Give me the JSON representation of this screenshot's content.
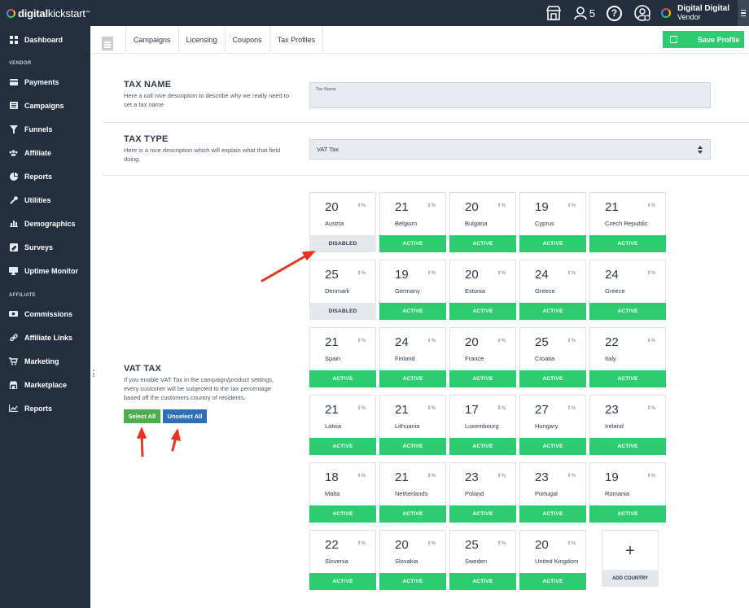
{
  "brand": {
    "logo_bold": "digital",
    "logo_light": "kickstart",
    "trademark": "™",
    "colors": {
      "dark": "#232f3e",
      "green": "#2ecc71",
      "blue": "#2f6fb3",
      "red_arrow": "#e8341c"
    }
  },
  "topbar": {
    "store_icon": "store-icon",
    "users_icon": "users-icon",
    "users_count": "5",
    "help_icon": "help-icon",
    "help_glyph": "?",
    "support_icon": "support-icon",
    "vendor_name": "Digital Digital",
    "vendor_role": "Vendor"
  },
  "sidebar": {
    "top": [
      {
        "label": "Dashboard",
        "icon": "dashboard-icon"
      }
    ],
    "vendor_heading": "VENDOR",
    "vendor": [
      {
        "label": "Payments",
        "icon": "payments-icon"
      },
      {
        "label": "Campaigns",
        "icon": "campaigns-icon"
      },
      {
        "label": "Funnels",
        "icon": "funnel-icon"
      },
      {
        "label": "Affiliate",
        "icon": "affiliate-icon"
      },
      {
        "label": "Reports",
        "icon": "reports-icon"
      },
      {
        "label": "Utilities",
        "icon": "wrench-icon"
      },
      {
        "label": "Demographics",
        "icon": "demographics-icon"
      },
      {
        "label": "Surveys",
        "icon": "surveys-icon"
      },
      {
        "label": "Uptime Monitor",
        "icon": "monitor-icon"
      }
    ],
    "affiliate_heading": "AFFILIATE",
    "affiliate": [
      {
        "label": "Commissions",
        "icon": "commissions-icon"
      },
      {
        "label": "Affiliate Links",
        "icon": "link-icon"
      },
      {
        "label": "Marketing",
        "icon": "cart-icon"
      },
      {
        "label": "Marketplace",
        "icon": "marketplace-icon"
      },
      {
        "label": "Reports",
        "icon": "line-chart-icon"
      }
    ]
  },
  "tabs": [
    "Campaigns",
    "Licensing",
    "Coupons",
    "Tax Profiles"
  ],
  "save_button": "Save Profile",
  "tax_name": {
    "title": "TAX NAME",
    "desc": "Here a coll nive description to describe why we really need to set a tax name",
    "placeholder": "Tax Name"
  },
  "tax_type": {
    "title": "TAX TYPE",
    "desc": "Here is a nice description which will explain what that field doing.",
    "value": "VAT Tax"
  },
  "vat_tax": {
    "title": "VAT TAX",
    "desc": "If you enable VAT Tax in the campaign/product settings, every customer will be subjected to the tax percentage based off the customers country of residents.",
    "select_all": "Select All",
    "unselect_all": "Unselect All"
  },
  "percent_label": "%",
  "countries": [
    {
      "rate": "20",
      "name": "Austria",
      "status": "DISABLED"
    },
    {
      "rate": "21",
      "name": "Belgium",
      "status": "ACTIVE"
    },
    {
      "rate": "20",
      "name": "Bulgaria",
      "status": "ACTIVE"
    },
    {
      "rate": "19",
      "name": "Cyprus",
      "status": "ACTIVE"
    },
    {
      "rate": "21",
      "name": "Czech Republic",
      "status": "ACTIVE"
    },
    {
      "rate": "25",
      "name": "Denmark",
      "status": "DISABLED"
    },
    {
      "rate": "19",
      "name": "Germany",
      "status": "ACTIVE"
    },
    {
      "rate": "20",
      "name": "Estonia",
      "status": "ACTIVE"
    },
    {
      "rate": "24",
      "name": "Greece",
      "status": "ACTIVE"
    },
    {
      "rate": "24",
      "name": "Greece",
      "status": "ACTIVE"
    },
    {
      "rate": "21",
      "name": "Spain",
      "status": "ACTIVE"
    },
    {
      "rate": "24",
      "name": "Finland",
      "status": "ACTIVE"
    },
    {
      "rate": "20",
      "name": "France",
      "status": "ACTIVE"
    },
    {
      "rate": "25",
      "name": "Croatia",
      "status": "ACTIVE"
    },
    {
      "rate": "22",
      "name": "Italy",
      "status": "ACTIVE"
    },
    {
      "rate": "21",
      "name": "Latvia",
      "status": "ACTIVE"
    },
    {
      "rate": "21",
      "name": "Lithuania",
      "status": "ACTIVE"
    },
    {
      "rate": "17",
      "name": "Luxembourg",
      "status": "ACTIVE"
    },
    {
      "rate": "27",
      "name": "Hungary",
      "status": "ACTIVE"
    },
    {
      "rate": "23",
      "name": "Ireland",
      "status": "ACTIVE"
    },
    {
      "rate": "18",
      "name": "Malta",
      "status": "ACTIVE"
    },
    {
      "rate": "21",
      "name": "Netherlands",
      "status": "ACTIVE"
    },
    {
      "rate": "23",
      "name": "Poland",
      "status": "ACTIVE"
    },
    {
      "rate": "23",
      "name": "Portugal",
      "status": "ACTIVE"
    },
    {
      "rate": "19",
      "name": "Romania",
      "status": "ACTIVE"
    },
    {
      "rate": "22",
      "name": "Slovenia",
      "status": "ACTIVE"
    },
    {
      "rate": "20",
      "name": "Slovakia",
      "status": "ACTIVE"
    },
    {
      "rate": "25",
      "name": "Sweden",
      "status": "ACTIVE"
    },
    {
      "rate": "20",
      "name": "United Kingdom",
      "status": "ACTIVE"
    }
  ],
  "add_country": {
    "plus": "+",
    "label": "ADD COUNTRY"
  }
}
